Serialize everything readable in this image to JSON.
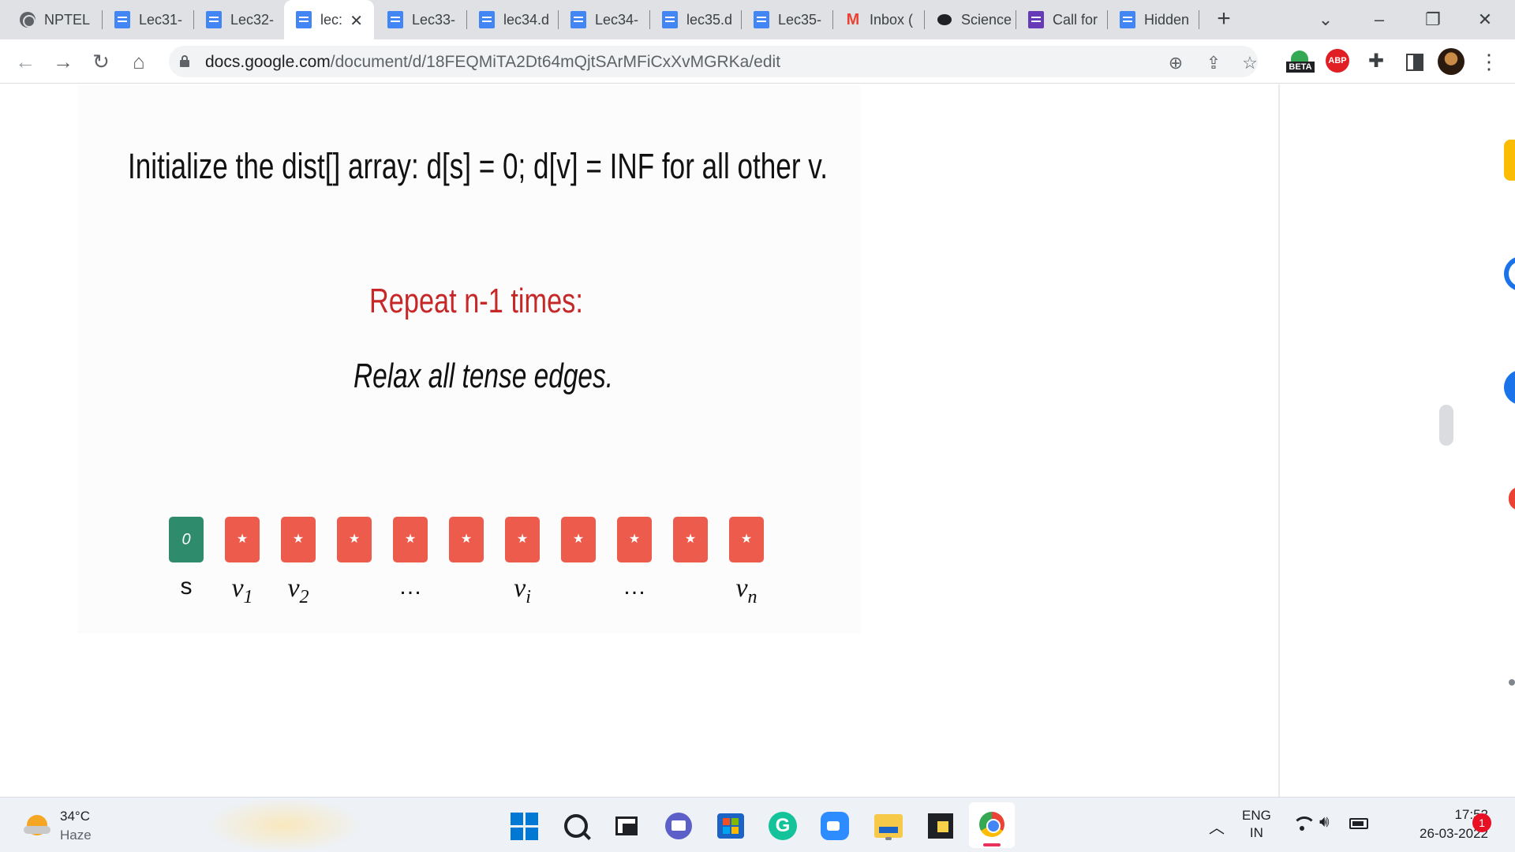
{
  "browser": {
    "tabs": [
      {
        "label": "NPTEL",
        "icon": "globe-icon"
      },
      {
        "label": "Lec31-",
        "icon": "docs-icon"
      },
      {
        "label": "Lec32-",
        "icon": "docs-icon"
      },
      {
        "label": "lec:",
        "icon": "docs-icon",
        "active": true
      },
      {
        "label": "Lec33-",
        "icon": "docs-icon"
      },
      {
        "label": "lec34.d",
        "icon": "docs-icon"
      },
      {
        "label": "Lec34-",
        "icon": "docs-icon"
      },
      {
        "label": "lec35.d",
        "icon": "docs-icon"
      },
      {
        "label": "Lec35-",
        "icon": "docs-icon"
      },
      {
        "label": "Inbox (",
        "icon": "gmail-icon"
      },
      {
        "label": "Science",
        "icon": "science-icon"
      },
      {
        "label": "Call for",
        "icon": "forms-icon"
      },
      {
        "label": "Hidden",
        "icon": "docs-icon"
      }
    ],
    "new_tab_symbol": "+",
    "close_symbol": "✕",
    "url_host": "docs.google.com",
    "url_path": "/document/d/18FEQMiTA2Dt64mQjtSArMFiCxXvMGRKa/edit",
    "beta_label": "BETA",
    "abp_label": "ABP"
  },
  "slide": {
    "line1": "Initialize the dist[] array: d[s] = 0; d[v] = INF for all other v.",
    "line2": "Repeat n-1 times:",
    "line3": "Relax all tense edges.",
    "nodes": [
      "0",
      "★",
      "★",
      "★",
      "★",
      "★",
      "★",
      "★",
      "★",
      "★",
      "★"
    ],
    "labels": {
      "s": "s",
      "v1_base": "v",
      "v1_sub": "1",
      "v2_base": "v",
      "v2_sub": "2",
      "dots1": "…",
      "vi_base": "v",
      "vi_sub": "i",
      "dots2": "…",
      "vn_base": "v",
      "vn_sub": "n"
    },
    "colors": {
      "source": "#2e8b6b",
      "other": "#ec5b4b",
      "title": "#c62828"
    }
  },
  "taskbar": {
    "weather_temp": "34°C",
    "weather_desc": "Haze",
    "lang_line1": "ENG",
    "lang_line2": "IN",
    "time": "17:52",
    "date": "26-03-2022",
    "notification_count": "1",
    "grammarly_letter": "G"
  }
}
